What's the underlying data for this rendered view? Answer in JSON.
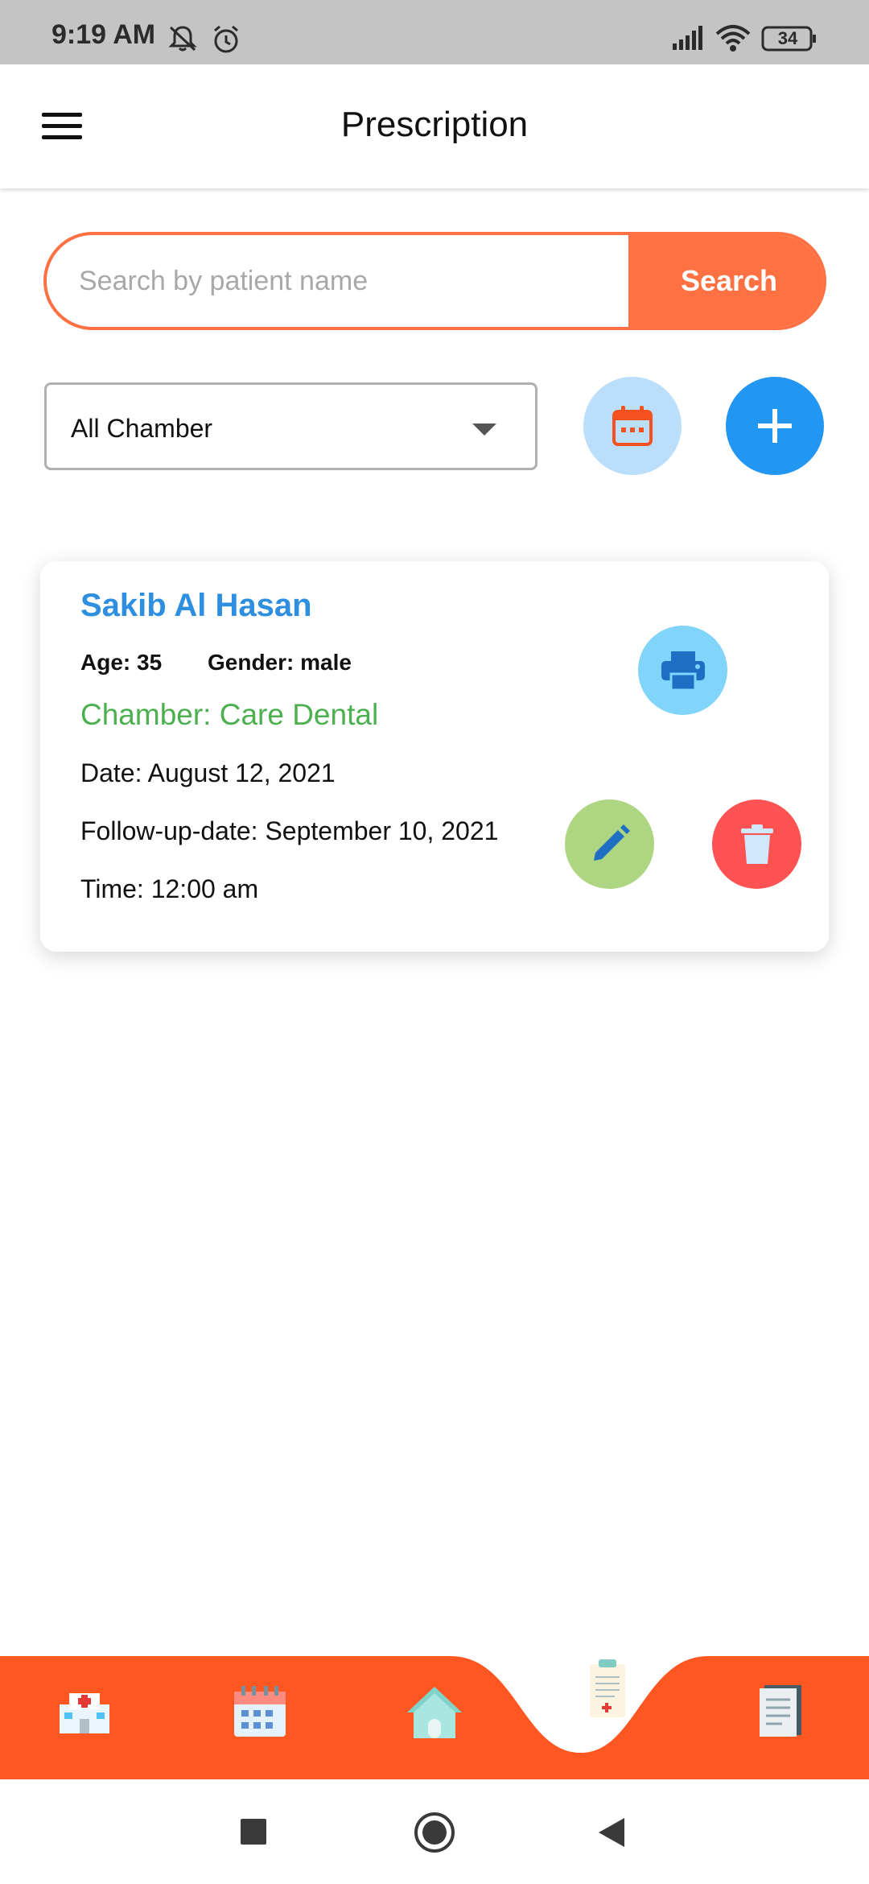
{
  "status_bar": {
    "time": "9:19 AM",
    "battery": "34",
    "icons": [
      "mute-icon",
      "alarm-icon",
      "signal-icon",
      "wifi-icon",
      "battery-icon"
    ]
  },
  "app_bar": {
    "title": "Prescription",
    "menu_icon": "hamburger-menu-icon"
  },
  "search": {
    "placeholder": "Search by patient name",
    "value": "",
    "button_label": "Search"
  },
  "filter": {
    "chamber_selected": "All Chamber",
    "calendar_icon": "calendar-icon",
    "add_icon": "plus-icon"
  },
  "prescriptions": [
    {
      "patient_name": "Sakib Al Hasan",
      "age": "Age: 35",
      "gender": "Gender: male",
      "chamber": "Chamber: Care Dental",
      "date": "Date: August 12, 2021",
      "follow_up": "Follow-up-date: September 10, 2021",
      "time": "Time: 12:00 am"
    }
  ],
  "bottom_nav": {
    "items": [
      "hospital-icon",
      "calendar-icon",
      "home-icon",
      "prescription-clipboard-icon",
      "notes-icon"
    ],
    "active_index": 3
  },
  "colors": {
    "accent": "#ff7043",
    "nav_bar": "#ff5722",
    "name_blue": "#2e8fe0",
    "chamber_green": "#4caf50",
    "add_button": "#2196f3",
    "delete_button": "#ff5252"
  }
}
